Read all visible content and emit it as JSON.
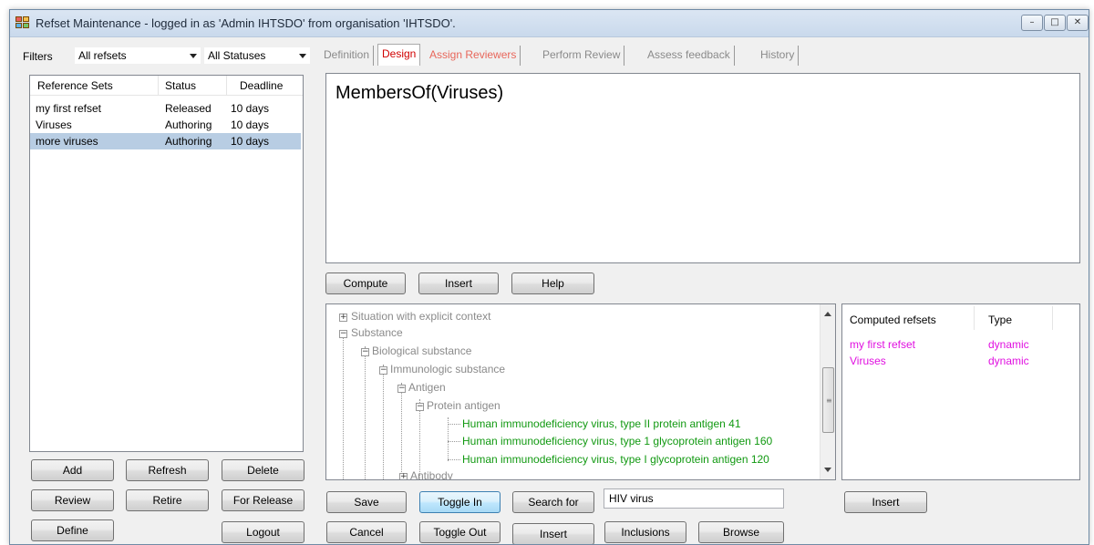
{
  "window": {
    "title": "Refset Maintenance - logged in as 'Admin IHTSDO' from organisation 'IHTSDO'."
  },
  "filters": {
    "label": "Filters",
    "refset_filter": "All refsets",
    "status_filter": "All Statuses"
  },
  "tabs": [
    {
      "label": "Definition"
    },
    {
      "label": "Design"
    },
    {
      "label": "Assign Reviewers"
    },
    {
      "label": "Perform Review"
    },
    {
      "label": "Assess feedback"
    },
    {
      "label": "History"
    }
  ],
  "refset_list": {
    "columns": [
      "Reference Sets",
      "Status",
      "Deadline"
    ],
    "rows": [
      {
        "name": "my first refset",
        "status": "Released",
        "deadline": "10 days"
      },
      {
        "name": "Viruses",
        "status": "Authoring",
        "deadline": "10 days"
      },
      {
        "name": "more viruses",
        "status": "Authoring",
        "deadline": "10 days"
      }
    ],
    "selected_index": 2
  },
  "left_buttons": {
    "add": "Add",
    "refresh": "Refresh",
    "delete": "Delete",
    "review": "Review",
    "retire": "Retire",
    "for_release": "For Release",
    "define": "Define",
    "logout": "Logout"
  },
  "editor": {
    "expression": "MembersOf(Viruses)"
  },
  "editor_buttons": {
    "compute": "Compute",
    "insert": "Insert",
    "help": "Help"
  },
  "tree": {
    "nodes": [
      {
        "label": "Situation with explicit context",
        "expander": "+"
      },
      {
        "label": "Substance",
        "expander": "-"
      },
      {
        "label": "Biological substance",
        "expander": "-"
      },
      {
        "label": "Immunologic substance",
        "expander": "-"
      },
      {
        "label": "Antigen",
        "expander": "-"
      },
      {
        "label": "Protein antigen",
        "expander": "-"
      },
      {
        "label": "Human immunodeficiency virus, type II protein antigen 41"
      },
      {
        "label": "Human immunodeficiency virus, type 1 glycoprotein antigen 160"
      },
      {
        "label": "Human immunodeficiency virus, type I glycoprotein antigen 120"
      },
      {
        "label": "Antibody",
        "expander": "+"
      }
    ]
  },
  "computed_refsets": {
    "columns": [
      "Computed refsets",
      "Type"
    ],
    "rows": [
      {
        "name": "my first refset",
        "type": "dynamic"
      },
      {
        "name": "Viruses",
        "type": "dynamic"
      }
    ],
    "insert_label": "Insert"
  },
  "bottom_buttons": {
    "save": "Save",
    "toggle_in": "Toggle In",
    "search_for": "Search for",
    "cancel": "Cancel",
    "toggle_out": "Toggle Out",
    "insert": "Insert",
    "inclusions": "Inclusions",
    "browse": "Browse"
  },
  "search": {
    "value": "HIV virus"
  },
  "colors": {
    "selected_row": "#b8cde3",
    "active_tab": "#d00000",
    "included_concept": "#119911",
    "computed_refset": "#e010e0"
  }
}
